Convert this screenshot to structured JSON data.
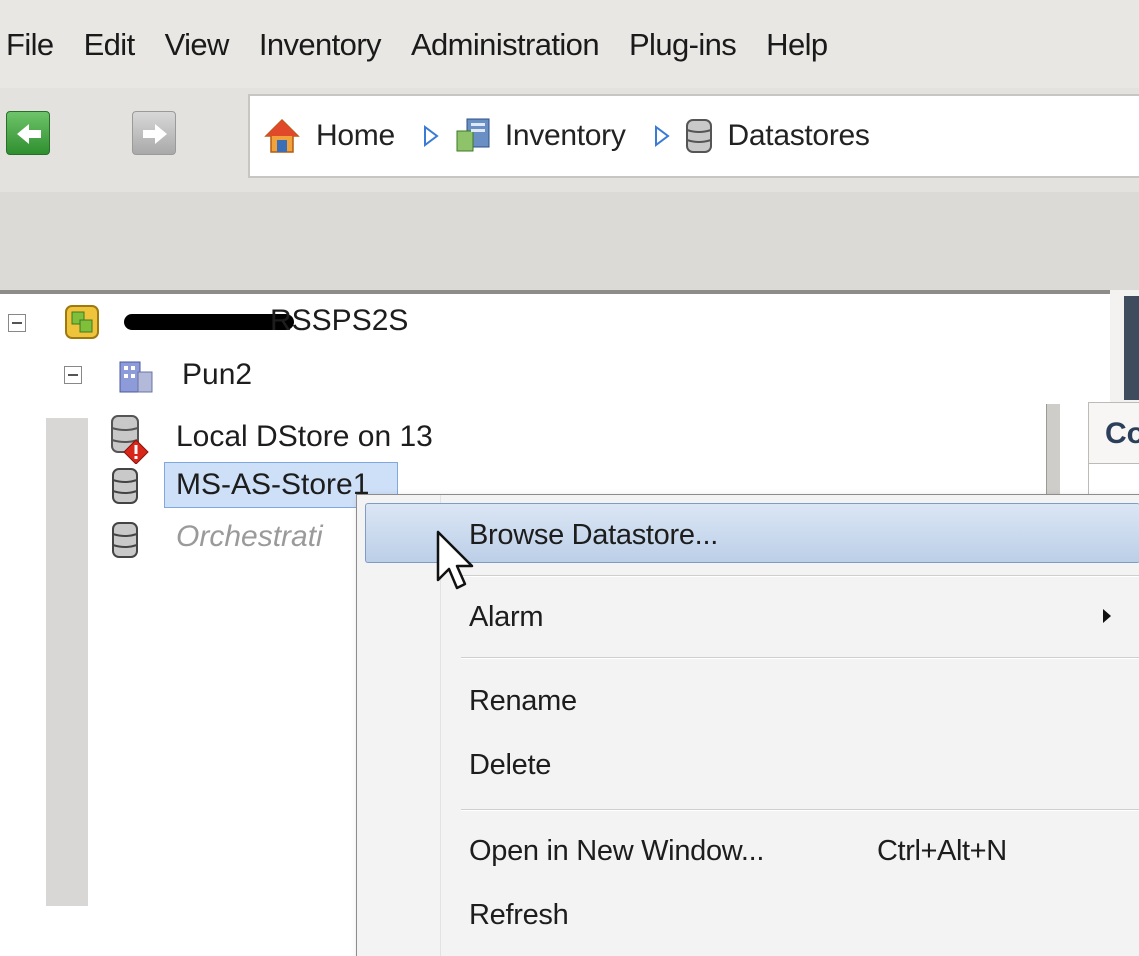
{
  "menubar": {
    "items": [
      "File",
      "Edit",
      "View",
      "Inventory",
      "Administration",
      "Plug-ins",
      "Help"
    ]
  },
  "navigation": {
    "back_icon": "back-arrow-icon",
    "forward_icon": "forward-arrow-icon",
    "breadcrumb": [
      {
        "label": "Home",
        "icon": "home-icon"
      },
      {
        "label": "Inventory",
        "icon": "inventory-icon"
      },
      {
        "label": "Datastores",
        "icon": "datastore-icon"
      }
    ]
  },
  "tree": {
    "root": {
      "label": "RSSPS2S",
      "icon": "vcenter-icon",
      "redacted": true
    },
    "datacenter": {
      "label": "Pun2",
      "icon": "datacenter-icon"
    },
    "datastores": [
      {
        "label": "Local DStore on 13",
        "icon": "datastore-alert-icon"
      },
      {
        "label": "MS-AS-Store1",
        "icon": "datastore-icon",
        "selected": true
      },
      {
        "label": "Orchestrati",
        "icon": "datastore-icon",
        "inactive": true
      }
    ]
  },
  "right_panel": {
    "tab_label": "Co"
  },
  "context_menu": {
    "items": [
      {
        "label": "Browse Datastore...",
        "highlighted": true
      },
      {
        "label": "Alarm",
        "submenu": true
      },
      {
        "label": "Rename"
      },
      {
        "label": "Delete"
      },
      {
        "label": "Open in New Window...",
        "shortcut": "Ctrl+Alt+N"
      },
      {
        "label": "Refresh"
      }
    ]
  },
  "colors": {
    "selection": "#cde0f7",
    "menu_highlight": "#bccfe8",
    "back_button": "#3d9e3a"
  }
}
